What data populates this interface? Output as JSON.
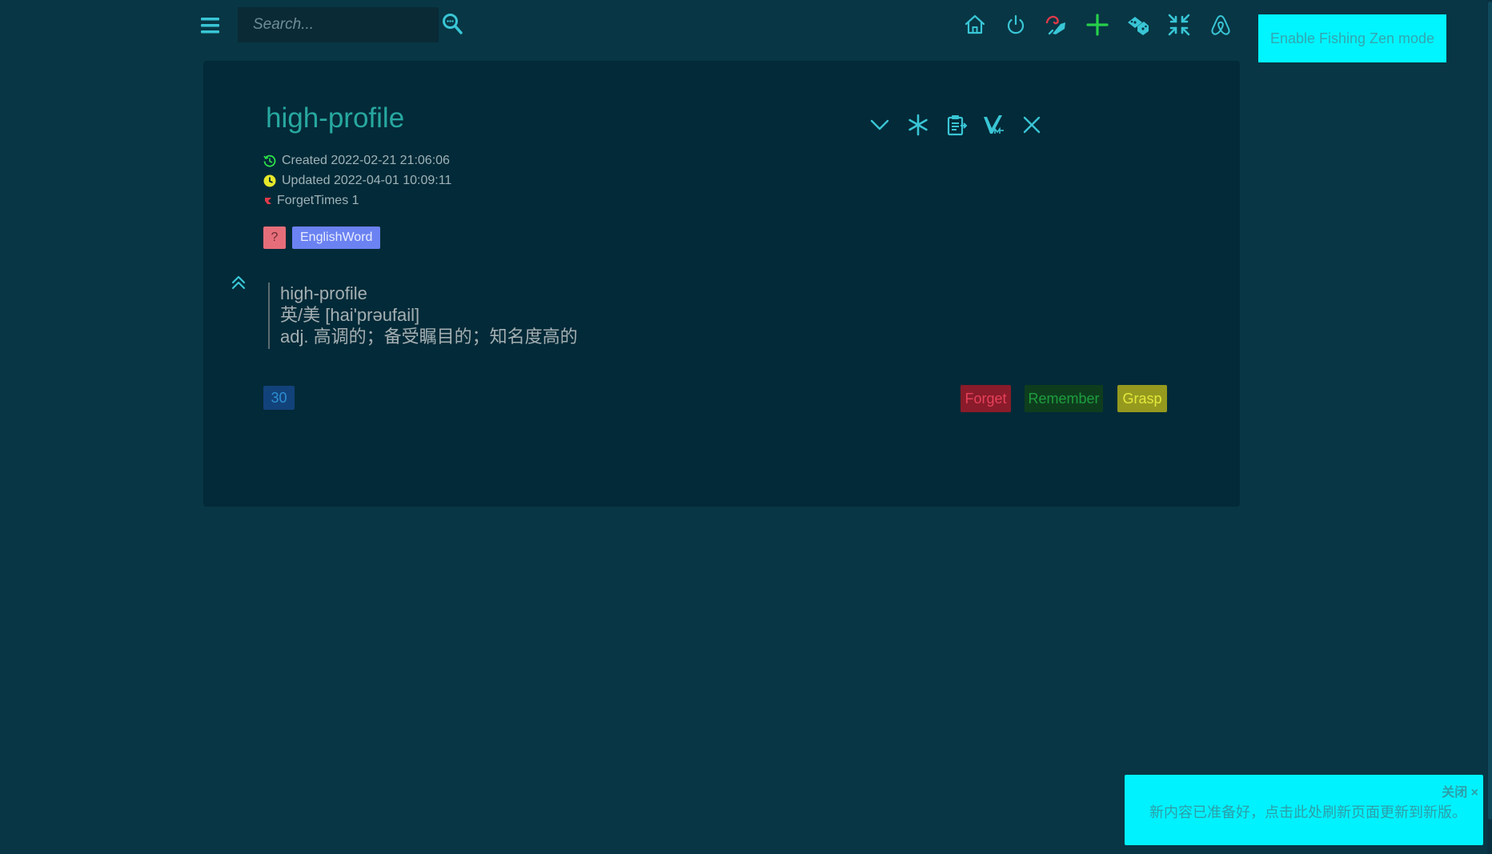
{
  "colors": {
    "background": "#083644",
    "card": "#032a38",
    "accent": "#00f5ff",
    "title": "#27a8a0",
    "icon": "#39c6d6"
  },
  "topbar": {
    "menu_icon": "hamburger-menu-icon",
    "search_placeholder": "Search...",
    "search_icon": "search-icon",
    "icons": [
      "home-icon",
      "power-icon",
      "fishing-icon",
      "add-icon",
      "dice-icon",
      "compress-icon",
      "airbnb-icon"
    ],
    "zen_button": "Enable Fishing Zen mode"
  },
  "card": {
    "title": "high-profile",
    "actions": [
      "chevron-down-icon",
      "asterisk-icon",
      "clipboard-icon",
      "markdown-icon",
      "close-icon"
    ],
    "meta": {
      "created": "Created 2022-02-21 21:06:06",
      "updated": "Updated 2022-04-01 10:09:11",
      "forget_times": "ForgetTimes 1"
    },
    "tags": {
      "question": "?",
      "category": "EnglishWord"
    },
    "content": {
      "word": "high-profile",
      "pronunciation": "英/美 [hai'prəufail]",
      "definition": "adj. 高调的；备受瞩目的；知名度高的"
    },
    "count": "30",
    "buttons": {
      "forget": "Forget",
      "remember": "Remember",
      "grasp": "Grasp"
    }
  },
  "notice": {
    "close": "关闭 ×",
    "text": "新内容已准备好，点击此处刷新页面更新到新版。"
  }
}
